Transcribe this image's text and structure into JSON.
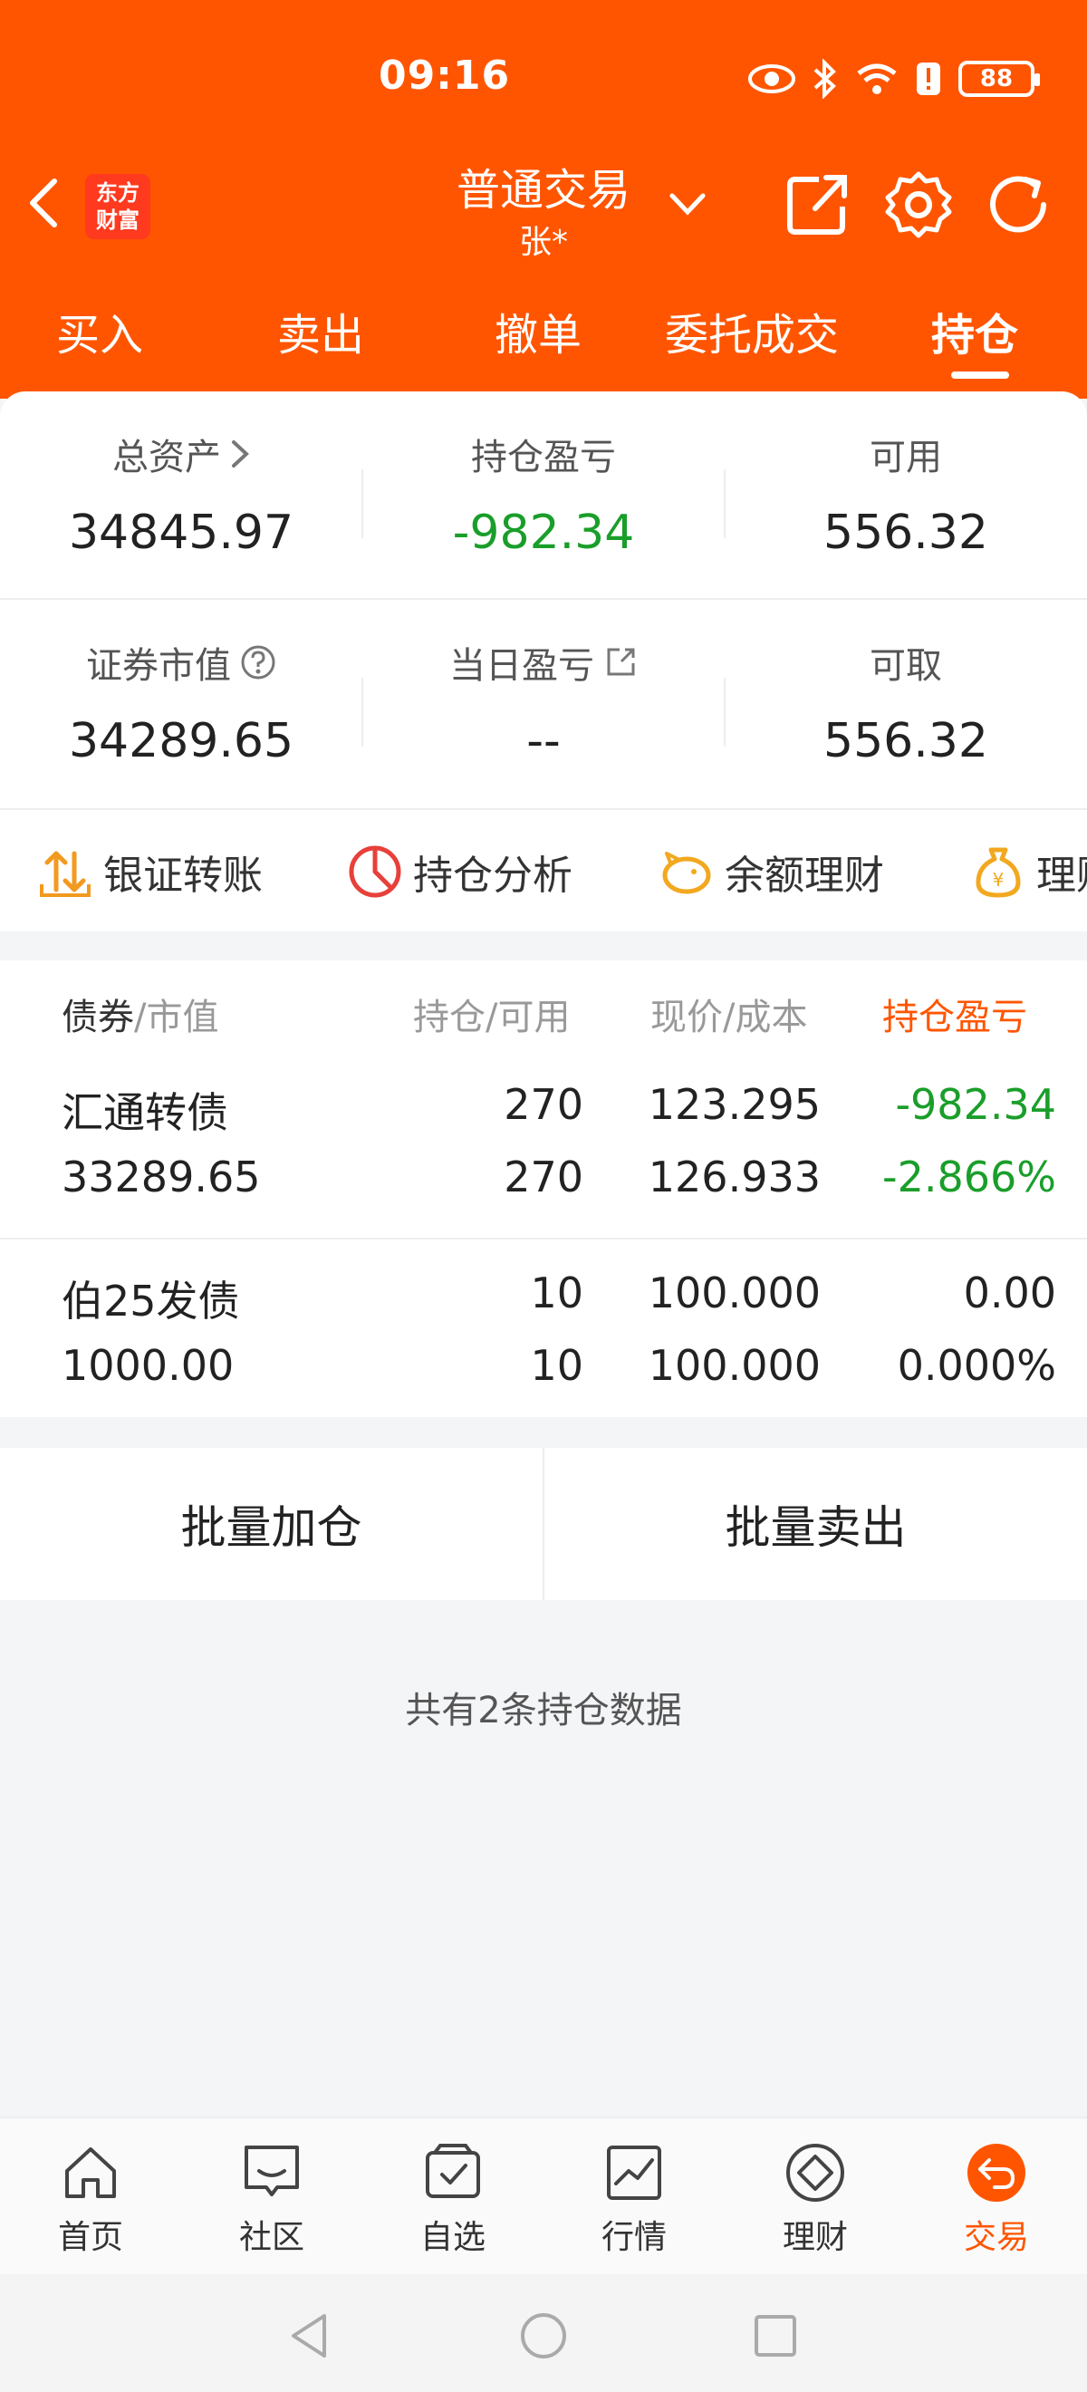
{
  "status": {
    "time": "09:16",
    "battery": "88"
  },
  "nav": {
    "logo_line1": "东方",
    "logo_line2": "财富",
    "title": "普通交易",
    "account": "张*"
  },
  "tabs": [
    "买入",
    "卖出",
    "撤单",
    "委托成交",
    "持仓"
  ],
  "summary": {
    "total_assets_label": "总资产",
    "total_assets": "34845.97",
    "position_pl_label": "持仓盈亏",
    "position_pl": "-982.34",
    "available_label": "可用",
    "available": "556.32",
    "market_value_label": "证券市值",
    "market_value": "34289.65",
    "daily_pl_label": "当日盈亏",
    "daily_pl": "--",
    "withdrawable_label": "可取",
    "withdrawable": "556.32"
  },
  "shortcuts": [
    "银证转账",
    "持仓分析",
    "余额理财",
    "理财"
  ],
  "table": {
    "col1_a": "债券",
    "col1_b": "/市值",
    "col2": "持仓/可用",
    "col3": "现价/成本",
    "col4": "持仓盈亏",
    "rows": [
      {
        "name": "汇通转债",
        "market_value": "33289.65",
        "position": "270",
        "available": "270",
        "price": "123.295",
        "cost": "126.933",
        "pl": "-982.34",
        "pl_pct": "-2.866%"
      },
      {
        "name": "伯25发债",
        "market_value": "1000.00",
        "position": "10",
        "available": "10",
        "price": "100.000",
        "cost": "100.000",
        "pl": "0.00",
        "pl_pct": "0.000%"
      }
    ]
  },
  "batch": {
    "add": "批量加仓",
    "sell": "批量卖出"
  },
  "count_text": "共有2条持仓数据",
  "bottom_nav": [
    "首页",
    "社区",
    "自选",
    "行情",
    "理财",
    "交易"
  ],
  "colors": {
    "brand": "#ff5500",
    "loss": "#1a9e2a"
  }
}
